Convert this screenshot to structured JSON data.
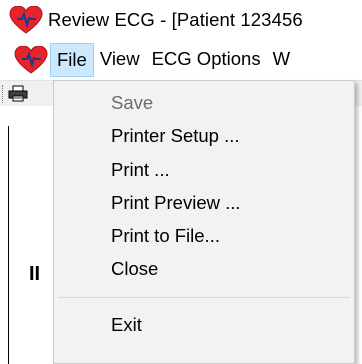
{
  "window": {
    "title": "Review ECG - [Patient 123456"
  },
  "menubar": {
    "items": [
      "File",
      "View",
      "ECG Options",
      "W"
    ]
  },
  "workspace": {
    "lead_label": "II"
  },
  "file_menu": {
    "items": [
      {
        "label": "Save",
        "enabled": false
      },
      {
        "label": "Printer Setup ...",
        "enabled": true
      },
      {
        "label": "Print ...",
        "enabled": true
      },
      {
        "label": "Print Preview ...",
        "enabled": true
      },
      {
        "label": "Print to File...",
        "enabled": true
      },
      {
        "label": "Close",
        "enabled": true
      },
      {
        "label": "Exit",
        "enabled": true
      }
    ]
  },
  "icons": {
    "app": "heart-ecg-icon",
    "toolbar_print": "printer-icon"
  },
  "colors": {
    "heart": "#e8242b",
    "menu_highlight": "#cce8ff",
    "disabled_text": "#6d6d6d"
  }
}
